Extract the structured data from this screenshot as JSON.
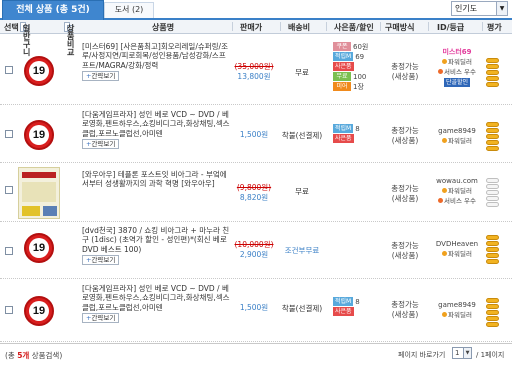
{
  "tabs": {
    "active": "전체 상품 (총 5건)",
    "other": "도서 (2)"
  },
  "sort": {
    "selected": "인기도",
    "arrow_icon": "chevron-down-icon"
  },
  "header": {
    "select": "선택",
    "btn_cart": "일반구니",
    "btn_compare": "상품비교",
    "product": "상품명",
    "price": "판매가",
    "shipping": "배송비",
    "benefit": "사은품/할인",
    "status": "구매방식",
    "seller": "ID/등급",
    "rating": "평가"
  },
  "rows": [
    {
      "badge": "19",
      "title": "[미스터69] [사은품최고]회오리레일/슈퍼링/조루/사정지연/피로회복/성인용품/남성강화/스프프트/MAGRA/강화/정력",
      "detail_btn": "간략보기",
      "old_price": "(35,000원)",
      "price": "13,800원",
      "shipping": "무료",
      "benefits": [
        {
          "tag": "쿠폰",
          "text": "60원"
        },
        {
          "tag": "적립M",
          "text": "69"
        },
        {
          "tag": "사은품",
          "text": ""
        },
        {
          "tag": "무료",
          "text": "100"
        },
        {
          "tag": "미어",
          "text": "1장"
        }
      ],
      "status_line1": "총정가능",
      "status_line2": "(새상품)",
      "seller_name": "미스터69",
      "grade_power": "파워딜러",
      "grade_service": "서비스 우수",
      "vip": "단골할인",
      "rating_level": 4
    },
    {
      "badge": "19",
      "title": "[다움게임프라자] 성인 베로 VCD ~ DVD / 베로영화,펜트하우스,쇼킹비디그라,화상채팅,섹스클럽,포르노클럽선,아미텐",
      "detail_btn": "간략보기",
      "old_price": "",
      "price": "1,500원",
      "shipping": "착불(선결제)",
      "benefits": [
        {
          "tag": "적립M",
          "text": "8"
        },
        {
          "tag": "사은품",
          "text": ""
        }
      ],
      "status_line1": "총정가능",
      "status_line2": "(새상품)",
      "seller_name": "game8949",
      "grade_power": "파워딜러",
      "grade_service": "",
      "vip": "",
      "rating_level": 4
    },
    {
      "badge": "",
      "title": "[와우아우] 테플론 포스트잇 비아그라 - 부엌에서부터 성생활까지의 과학 혁명 [와우아우]",
      "detail_btn": "간략보기",
      "old_price": "(9,800원)",
      "price": "8,820원",
      "shipping": "무료",
      "benefits": [],
      "status_line1": "총정가능",
      "status_line2": "(새상품)",
      "seller_name": "wowau.com",
      "grade_power": "파워딜러",
      "grade_service": "서비스 우수",
      "vip": "",
      "rating_level": 0
    },
    {
      "badge": "19",
      "title": "[dvd천국] 3870 / 쇼킹 비아그라 + 마누라 친구 (1disc) (초역가 할인 - 성인편)*(회신 베로 DVD 베스트 100)",
      "detail_btn": "간략보기",
      "old_price": "(10,000원)",
      "price": "2,900원",
      "shipping": "조건부무료",
      "benefits": [],
      "status_line1": "총정가능",
      "status_line2": "(새상품)",
      "seller_name": "DVDHeaven",
      "grade_power": "파워딜러",
      "grade_service": "",
      "vip": "",
      "rating_level": 4
    },
    {
      "badge": "19",
      "title": "[다움게임프라자] 성인 베로 VCD ~ DVD / 베로영화,펜트하우스,쇼킹비디그라,화상채팅,섹스클럽,포르노클럽선,아미텐",
      "detail_btn": "간략보기",
      "old_price": "",
      "price": "1,500원",
      "shipping": "착불(선결제)",
      "benefits": [
        {
          "tag": "적립M",
          "text": "8"
        },
        {
          "tag": "사은품",
          "text": ""
        }
      ],
      "status_line1": "총정가능",
      "status_line2": "(새상품)",
      "seller_name": "game8949",
      "grade_power": "파워딜러",
      "grade_service": "",
      "vip": "",
      "rating_level": 4
    }
  ],
  "footer": {
    "total_prefix": "(총 ",
    "total_count": "5개",
    "total_suffix": " 상품검색)",
    "page_label": "페이지 바로가기",
    "page_value": "1",
    "page_total": "/ 1페이지"
  }
}
